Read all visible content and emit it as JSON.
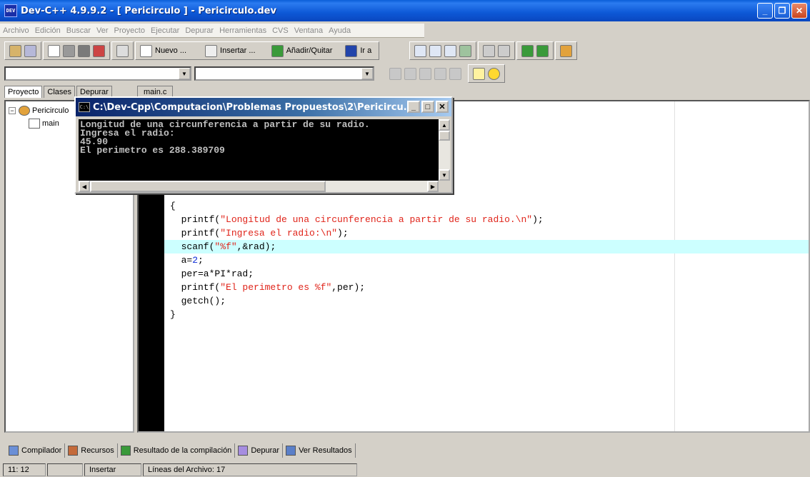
{
  "window": {
    "title": "Dev-C++ 4.9.9.2  - [ Pericirculo ] - Pericirculo.dev",
    "icon_text": "DEV"
  },
  "menu": [
    "Archivo",
    "Edición",
    "Buscar",
    "Ver",
    "Proyecto",
    "Ejecutar",
    "Depurar",
    "Herramientas",
    "CVS",
    "Ventana",
    "Ayuda"
  ],
  "toolbar": {
    "nuevo": "Nuevo ...",
    "insertar": "Insertar ...",
    "anadir": "Añadir/Quitar",
    "ir_a": "Ir a"
  },
  "left_tabs": [
    "Proyecto",
    "Clases",
    "Depurar"
  ],
  "tree": {
    "project": "Pericirculo",
    "file": "main"
  },
  "editor": {
    "tab": "main.c",
    "code": [
      {
        "text": "{",
        "parts": [
          {
            "t": "{",
            "c": ""
          }
        ]
      },
      {
        "parts": [
          {
            "t": "  printf(",
            "c": ""
          },
          {
            "t": "\"Longitud de una circunferencia a partir de su radio.\\n\"",
            "c": "str"
          },
          {
            "t": ");",
            "c": ""
          }
        ]
      },
      {
        "parts": [
          {
            "t": "  printf(",
            "c": ""
          },
          {
            "t": "\"Ingresa el radio:\\n\"",
            "c": "str"
          },
          {
            "t": ");",
            "c": ""
          }
        ]
      },
      {
        "hl": true,
        "parts": [
          {
            "t": "  scanf(",
            "c": ""
          },
          {
            "t": "\"%f\"",
            "c": "str"
          },
          {
            "t": ",&rad);",
            "c": ""
          }
        ]
      },
      {
        "parts": [
          {
            "t": "  a=",
            "c": ""
          },
          {
            "t": "2",
            "c": "num"
          },
          {
            "t": ";",
            "c": ""
          }
        ]
      },
      {
        "parts": [
          {
            "t": "  per=a*PI*rad;",
            "c": ""
          }
        ]
      },
      {
        "parts": [
          {
            "t": "  printf(",
            "c": ""
          },
          {
            "t": "\"El perimetro es %f\"",
            "c": "str"
          },
          {
            "t": ",per);",
            "c": ""
          }
        ]
      },
      {
        "parts": [
          {
            "t": "  getch();",
            "c": ""
          }
        ]
      },
      {
        "parts": [
          {
            "t": "}",
            "c": ""
          }
        ]
      }
    ]
  },
  "console": {
    "title": "C:\\Dev-Cpp\\Computacion\\Problemas Propuestos\\2\\Pericircu...",
    "icon_text": "C:\\",
    "lines": [
      "Longitud de una circunferencia a partir de su radio.",
      "Ingresa el radio:",
      "45.90",
      "El perimetro es 288.389709"
    ]
  },
  "bottom_tabs": [
    "Compilador",
    "Recursos",
    "Resultado de la compilación",
    "Depurar",
    "Ver Resultados"
  ],
  "status": {
    "position": "11: 12",
    "mode": "Insertar",
    "lines": "Líneas del Archivo: 17"
  },
  "colors": {
    "string": "#e0241a",
    "number": "#0b2bd8",
    "highlight": "#ccffff"
  }
}
